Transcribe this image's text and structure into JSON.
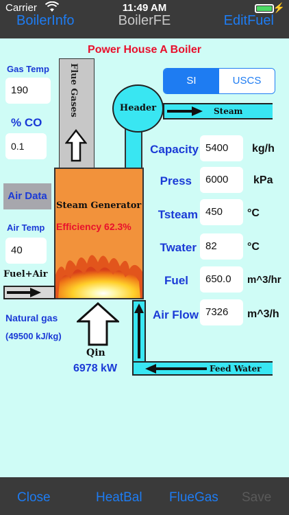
{
  "status": {
    "carrier": "Carrier",
    "time": "11:49 AM"
  },
  "nav": {
    "left": "BoilerInfo",
    "title": "BoilerFE",
    "right": "EditFuel"
  },
  "diagram": {
    "title": "Power House A Boiler",
    "flue_gases": "Flue Gases",
    "header": "Header",
    "steam": "Steam",
    "generator": "Steam Generator",
    "efficiency": "Efficiency 62.3%",
    "fuel_air": "Fuel+Air",
    "feed_water": "Feed Water",
    "qin_label": "Qin",
    "qin_value": "6978 kW",
    "fuel_name": "Natural gas",
    "fuel_hv": "(49500 kJ/kg)"
  },
  "left": {
    "gas_temp_label": "Gas Temp",
    "gas_temp_value": "190",
    "co_label": "% CO",
    "co_value": "0.1",
    "air_data_button": "Air Data",
    "air_temp_label": "Air Temp",
    "air_temp_value": "40"
  },
  "units_toggle": {
    "si": "SI",
    "uscs": "USCS",
    "selected": "SI"
  },
  "params": [
    {
      "label": "Capacity",
      "value": "5400",
      "unit": "kg/h"
    },
    {
      "label": "Press",
      "value": "6000",
      "unit": "kPa"
    },
    {
      "label": "Tsteam",
      "value": "450",
      "unit": "°C"
    },
    {
      "label": "Twater",
      "value": "82",
      "unit": "°C"
    },
    {
      "label": "Fuel",
      "value": "650.0",
      "unit": "m^3/hr"
    },
    {
      "label": "Air Flow",
      "value": "7326",
      "unit": "m^3/h"
    }
  ],
  "toolbar": {
    "close": "Close",
    "heatbal": "HeatBal",
    "fluegas": "FlueGas",
    "save": "Save"
  },
  "colors": {
    "accent": "#1e7cf2",
    "background": "#cffcf6",
    "pipe": "#39e6f2",
    "generator": "#f2923b",
    "title_red": "#e8102c"
  },
  "icons": [
    "wifi-icon",
    "battery-icon",
    "charging-bolt-icon",
    "up-arrow-icon",
    "right-arrow-icon",
    "left-arrow-icon",
    "flame-icon"
  ]
}
